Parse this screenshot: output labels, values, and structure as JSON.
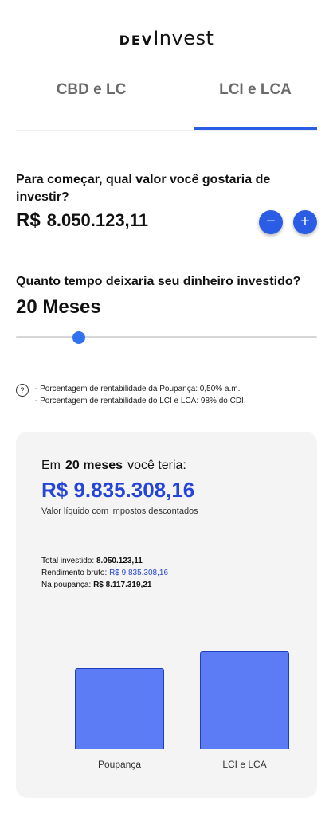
{
  "app": {
    "logo_dev": "DEV",
    "logo_rest": "Invest"
  },
  "tabs": [
    {
      "label": "CBD e LC",
      "active": false
    },
    {
      "label": "LCI e LCA",
      "active": true
    }
  ],
  "investment": {
    "question": "Para começar, qual valor você gostaria de investir?",
    "currency": "R$",
    "amount": "8.050.123,11",
    "minus_label": "−",
    "plus_label": "+"
  },
  "duration": {
    "question": "Quanto tempo deixaria seu dinheiro investido?",
    "value_label": "20 Meses",
    "slider_fraction": 0.21
  },
  "info": {
    "icon": "?",
    "lines": [
      "- Porcentagem de rentabilidade da Poupança: 0,50% a.m.",
      "- Porcentagem de rentabilidade do LCI e LCA: 98% do CDI."
    ]
  },
  "result": {
    "prefix": "Em",
    "months": "20 meses",
    "suffix": "você teria:",
    "total": "R$ 9.835.308,16",
    "subtitle": "Valor líquido com impostos descontados",
    "total_invested_label": "Total investido:",
    "total_invested_value": "8.050.123,11",
    "gross_label": "Rendimento bruto:",
    "gross_value": "R$ 9.835.308,16",
    "savings_label": "Na poupança:",
    "savings_value": "R$ 8.117.319,21"
  },
  "chart_data": {
    "type": "bar",
    "categories": [
      "Poupança",
      "LCI e LCA"
    ],
    "values": [
      8117319.21,
      9835308.16
    ],
    "title": "",
    "xlabel": "",
    "ylabel": "",
    "ylim": [
      0,
      11900000
    ],
    "grid": false,
    "bar_color": "#5b7cf5",
    "bar_border": "#1f3fbf"
  },
  "colors": {
    "accent": "#2b5ce6",
    "total_text": "#2545d8"
  }
}
